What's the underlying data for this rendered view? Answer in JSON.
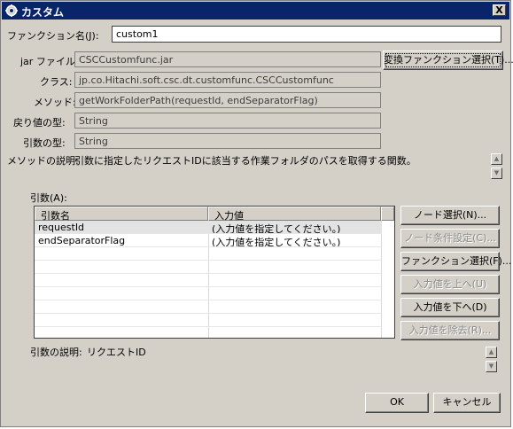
{
  "window": {
    "title": "カスタム",
    "close_label": "X"
  },
  "function_name": {
    "label": "ファンクション名(J):",
    "value": "custom1"
  },
  "jar_file": {
    "label": "jar ファイル:",
    "value": "CSCCustomfunc.jar"
  },
  "class": {
    "label": "クラス:",
    "value": "jp.co.Hitachi.soft.csc.dt.customfunc.CSCCustomfunc"
  },
  "method": {
    "label": "メソッド:",
    "value": "getWorkFolderPath(requestId, endSeparatorFlag)"
  },
  "return_type": {
    "label": "戻り値の型:",
    "value": "String"
  },
  "arg_type": {
    "label": "引数の型:",
    "value": "String"
  },
  "method_desc": {
    "label": "メソッドの説明:",
    "value": "引数に指定したリクエストIDに該当する作業フォルダのパスを取得する関数。"
  },
  "select_function_button": "変換ファンクション選択(T)...",
  "args": {
    "label": "引数(A):",
    "columns": [
      "引数名",
      "入力値"
    ],
    "rows": [
      {
        "name": "requestId",
        "value": "(入力値を指定してください。)"
      },
      {
        "name": "endSeparatorFlag",
        "value": "(入力値を指定してください。)"
      }
    ]
  },
  "side_buttons": {
    "node_select": "ノード選択(N)...",
    "node_condition": "ノード条件設定(C)...",
    "function_select": "ファンクション選択(F)...",
    "move_up": "入力値を上へ(U)",
    "move_down": "入力値を下へ(D)",
    "remove": "入力値を除去(R)..."
  },
  "arg_desc": {
    "label": "引数の説明:",
    "value": "リクエストID"
  },
  "footer": {
    "ok": "OK",
    "cancel": "キャンセル"
  },
  "icons": {
    "app": "gear-icon",
    "up": "up-arrow-icon",
    "down": "down-arrow-icon"
  }
}
